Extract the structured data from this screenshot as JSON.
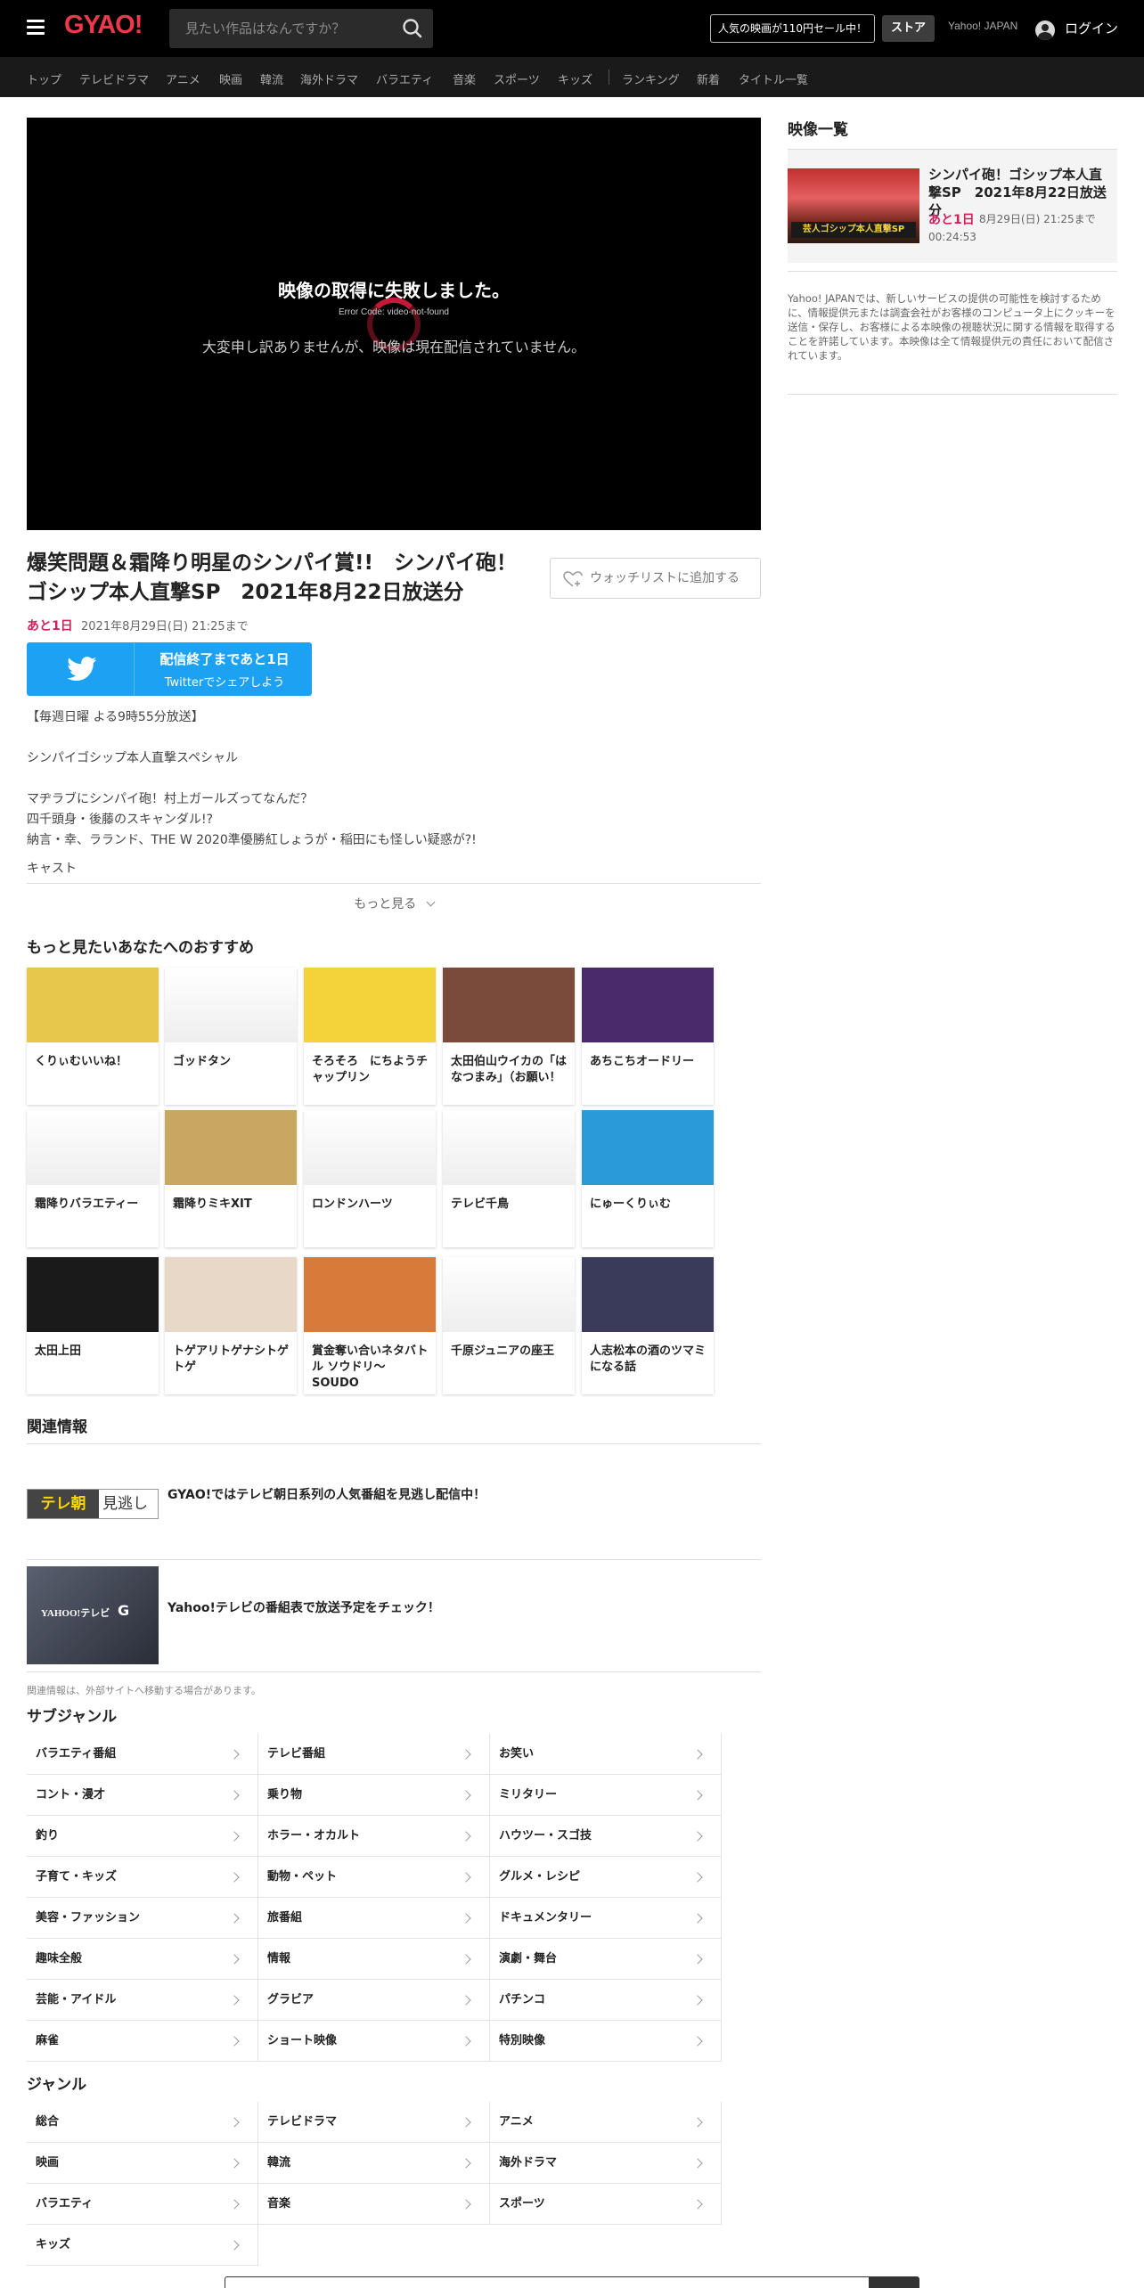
{
  "header": {
    "logo": "GYAO!",
    "search_placeholder": "見たい作品はなんですか？",
    "promo": "人気の映画が110円セール中！",
    "store": "ストア",
    "yahoo_japan": "Yahoo! JAPAN",
    "login": "ログイン"
  },
  "nav": [
    "トップ",
    "テレビドラマ",
    "アニメ",
    "映画",
    "韓流",
    "海外ドラマ",
    "バラエティ",
    "音楽",
    "スポーツ",
    "キッズ",
    "ランキング",
    "新着",
    "タイトル一覧"
  ],
  "player": {
    "error_title": "映像の取得に失敗しました。",
    "error_code": "Error Code: video-not-found",
    "error_message": "大変申し訳ありませんが、映像は現在配信されていません。"
  },
  "video": {
    "title": "爆笑問題＆霜降り明星のシンパイ賞!!　シンパイ砲！ゴシップ本人直撃SP　2021年8月22日放送分",
    "watchlist": "ウォッチリストに追加する",
    "remaining": "あと1日",
    "end_date": "2021年8月29日(日) 21:25まで",
    "twitter_line1": "配信終了まであと1日",
    "twitter_line2": "Twitterでシェアしよう",
    "desc": [
      "【毎週日曜 よる9時55分放送】",
      "シンパイゴシップ本人直撃スペシャル",
      "マヂラブにシンパイ砲！村上ガールズってなんだ？",
      "四千頭身・後藤のスキャンダル!?",
      "納言・幸、ラランド、THE W 2020準優勝紅しょうが・稲田にも怪しい疑惑が?!",
      "キャスト"
    ],
    "more": "もっと見る"
  },
  "recommend": {
    "heading": "もっと見たいあなたへのおすすめ",
    "items": [
      {
        "title": "くりぃむいいね！",
        "color": "#e8c84a"
      },
      {
        "title": "ゴッドタン",
        "color": "#ffffff"
      },
      {
        "title": "そろそろ　にちようチャップリン",
        "color": "#f4d23a"
      },
      {
        "title": "太田伯山ウイカの「はなつまみ」（お願い！",
        "color": "#7a4a3a"
      },
      {
        "title": "あちこちオードリー",
        "color": "#4a2a6a"
      },
      {
        "title": "霜降りバラエティー",
        "color": "#ffffff"
      },
      {
        "title": "霜降りミキXIT",
        "color": "#c8a860"
      },
      {
        "title": "ロンドンハーツ",
        "color": "#ffffff"
      },
      {
        "title": "テレビ千鳥",
        "color": "#ffffff"
      },
      {
        "title": "にゅーくりぃむ",
        "color": "#2a9ad8"
      },
      {
        "title": "太田上田",
        "color": "#1a1a1a"
      },
      {
        "title": "トゲアリトゲナシトゲトゲ",
        "color": "#e8d8c8"
      },
      {
        "title": "賞金奪い合いネタバトル ソウドリ～SOUDO",
        "color": "#d87a3a"
      },
      {
        "title": "千原ジュニアの座王",
        "color": "#f4f4f4"
      },
      {
        "title": "人志松本の酒のツマミになる話",
        "color": "#3a3a5a"
      }
    ]
  },
  "related": {
    "heading": "関連情報",
    "items": [
      {
        "title": "GYAO!ではテレビ朝日系列の人気番組を見逃し配信中！",
        "logo_a": "テレ朝",
        "logo_b": "見逃し"
      },
      {
        "title": "Yahoo!テレビの番組表で放送予定をチェック！",
        "logo_a": "YAHOO!テレビ",
        "logo_b": "G"
      }
    ],
    "note": "関連情報は、外部サイトへ移動する場合があります。"
  },
  "subgenre": {
    "heading": "サブジャンル",
    "items": [
      "バラエティ番組",
      "テレビ番組",
      "お笑い",
      "コント・漫才",
      "乗り物",
      "ミリタリー",
      "釣り",
      "ホラー・オカルト",
      "ハウツー・スゴ技",
      "子育て・キッズ",
      "動物・ペット",
      "グルメ・レシピ",
      "美容・ファッション",
      "旅番組",
      "ドキュメンタリー",
      "趣味全般",
      "情報",
      "演劇・舞台",
      "芸能・アイドル",
      "グラビア",
      "パチンコ",
      "麻雀",
      "ショート映像",
      "特別映像"
    ]
  },
  "genre": {
    "heading": "ジャンル",
    "items": [
      "総合",
      "テレビドラマ",
      "アニメ",
      "映画",
      "韓流",
      "海外ドラマ",
      "バラエティ",
      "音楽",
      "スポーツ",
      "キッズ"
    ]
  },
  "sidebar": {
    "heading": "映像一覧",
    "card_title": "シンパイ砲！ゴシップ本人直撃SP　2021年8月22日放送分",
    "card_remaining": "あと1日",
    "card_date": "8月29日(日) 21:25まで",
    "card_length": "00:24:53",
    "notice": "Yahoo! JAPANでは、新しいサービスの提供の可能性を検討するために、情報提供元または調査会社がお客様のコンピュータ上にクッキーを送信・保存し、お客様による本映像の視聴状況に関する情報を取得することを許諾しています。本映像は全て情報提供元の責任において配信されています。"
  },
  "colors": {
    "accent": "#f0384b",
    "remaining": "#d0225a",
    "twitter": "#1da1f2"
  }
}
